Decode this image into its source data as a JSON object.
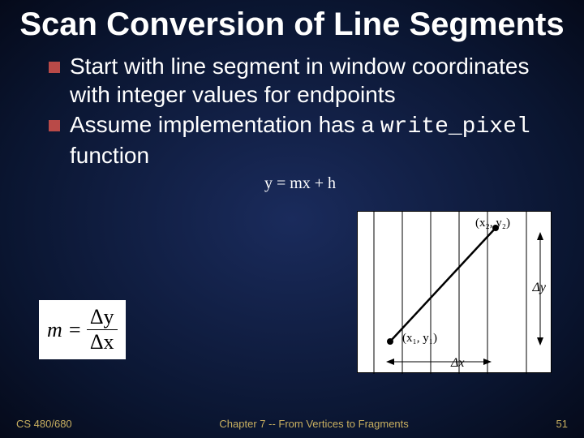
{
  "title": "Scan Conversion of Line Segments",
  "bullets": [
    "Start with line segment in window coordinates with integer values for endpoints",
    "Assume implementation has a "
  ],
  "bullet2_code": "write_pixel",
  "bullet2_tail": " function",
  "equation": "y = mx + h",
  "formula": {
    "lhs": "m =",
    "num": "Δy",
    "den": "Δx"
  },
  "diagram": {
    "p2": "(x₂, y₂)",
    "p1": "(x₁, y₁)",
    "dy": "Δy",
    "dx": "Δx"
  },
  "footer": {
    "left": "CS 480/680",
    "center": "Chapter 7 -- From Vertices to Fragments",
    "right": "51"
  }
}
